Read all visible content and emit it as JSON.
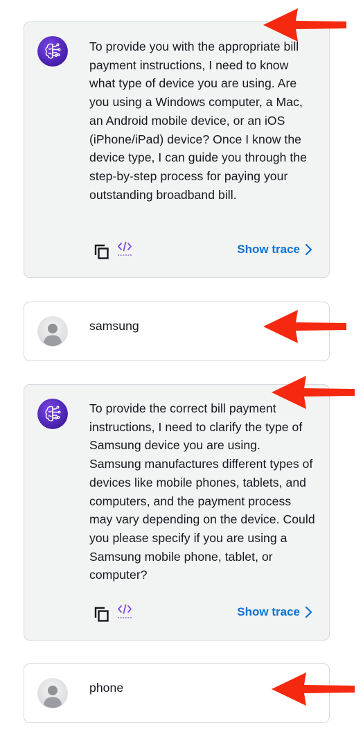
{
  "messages": [
    {
      "role": "assistant",
      "avatar_icon": "ai-brain-icon",
      "text": "To provide you with the appropriate bill payment instructions, I need to know what type of device you are using. Are you using a Windows computer, a Mac, an Android mobile device, or an iOS (iPhone/iPad) device? Once I know the device type, I can guide you through the step-by-step process for paying your outstanding broadband bill.",
      "trace_label": "Show trace"
    },
    {
      "role": "user",
      "avatar_icon": "user-avatar-icon",
      "text": "samsung"
    },
    {
      "role": "assistant",
      "avatar_icon": "ai-brain-icon",
      "text": "To provide the correct bill payment instructions, I need to clarify the type of Samsung device you are using. Samsung manufactures different types of devices like mobile phones, tablets, and computers, and the payment process may vary depending on the device. Could you please specify if you are using a Samsung mobile phone, tablet, or computer?",
      "trace_label": "Show trace"
    },
    {
      "role": "user",
      "avatar_icon": "user-avatar-icon",
      "text": "phone"
    }
  ],
  "icons": {
    "copy": "copy-icon",
    "code": "code-icon",
    "chevron": "chevron-right-icon",
    "annotation": "red-arrow-icon"
  },
  "colors": {
    "assistant_bg": "#f2f3f3",
    "user_bg": "#ffffff",
    "border": "#d5d9de",
    "link": "#0972d3",
    "ai_avatar": "#5b2bc8",
    "annotation_arrow": "#f4290f"
  }
}
